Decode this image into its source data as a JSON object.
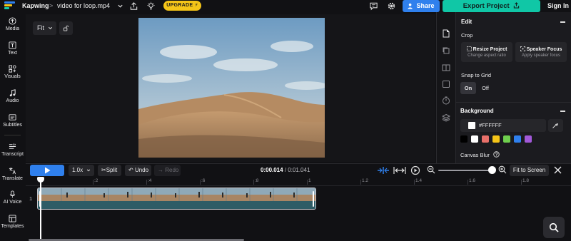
{
  "header": {
    "brand": "Kapwing",
    "breadcrumb_sep": ">",
    "project_name": "video for loop.mp4",
    "upgrade_label": "UPGRADE",
    "share_label": "Share",
    "export_label": "Export Project",
    "signin_label": "Sign In"
  },
  "sidebar": {
    "items": [
      {
        "label": "Media",
        "icon": "upload-icon"
      },
      {
        "label": "Text",
        "icon": "text-icon"
      },
      {
        "label": "Visuals",
        "icon": "shapes-icon"
      },
      {
        "label": "Audio",
        "icon": "music-note-icon"
      },
      {
        "label": "Subtitles",
        "icon": "subtitles-icon"
      },
      {
        "label": "Transcript",
        "icon": "transcript-icon"
      },
      {
        "label": "Translate",
        "icon": "translate-icon"
      },
      {
        "label": "AI Voice",
        "icon": "microphone-icon"
      },
      {
        "label": "Templates",
        "icon": "templates-icon"
      }
    ]
  },
  "canvas": {
    "fit_label": "Fit"
  },
  "panel": {
    "title": "Edit",
    "crop_label": "Crop",
    "resize_title": "Resize Project",
    "resize_sub": "Change aspect ratio",
    "speaker_title": "Speaker Focus",
    "speaker_sub": "Apply speaker focus",
    "snap_label": "Snap to Grid",
    "snap_on": "On",
    "snap_off": "Off",
    "background_title": "Background",
    "background_hex": "#FFFFFF",
    "swatches": [
      "#000000",
      "#ffffff",
      "#e8706a",
      "#f5c518",
      "#6fcf4e",
      "#2f80ed",
      "#a259d9"
    ],
    "canvas_blur_label": "Canvas Blur"
  },
  "timeline": {
    "speed_label": "1.0x",
    "split_label": "Split",
    "undo_label": "Undo",
    "redo_label": "Redo",
    "time_current": "0:00.014",
    "time_sep": " / ",
    "time_total": "0:01.041",
    "fit_screen_label": "Fit to Screen",
    "ruler_ticks": [
      ":2",
      ":4",
      ":6",
      ":8",
      "1",
      "1.2",
      "1.4",
      "1.6",
      "1.8"
    ],
    "track_number": "1"
  },
  "colors": {
    "accent_blue": "#2f80ed",
    "export_green": "#10c7a6",
    "upgrade_yellow": "#f5c518"
  }
}
